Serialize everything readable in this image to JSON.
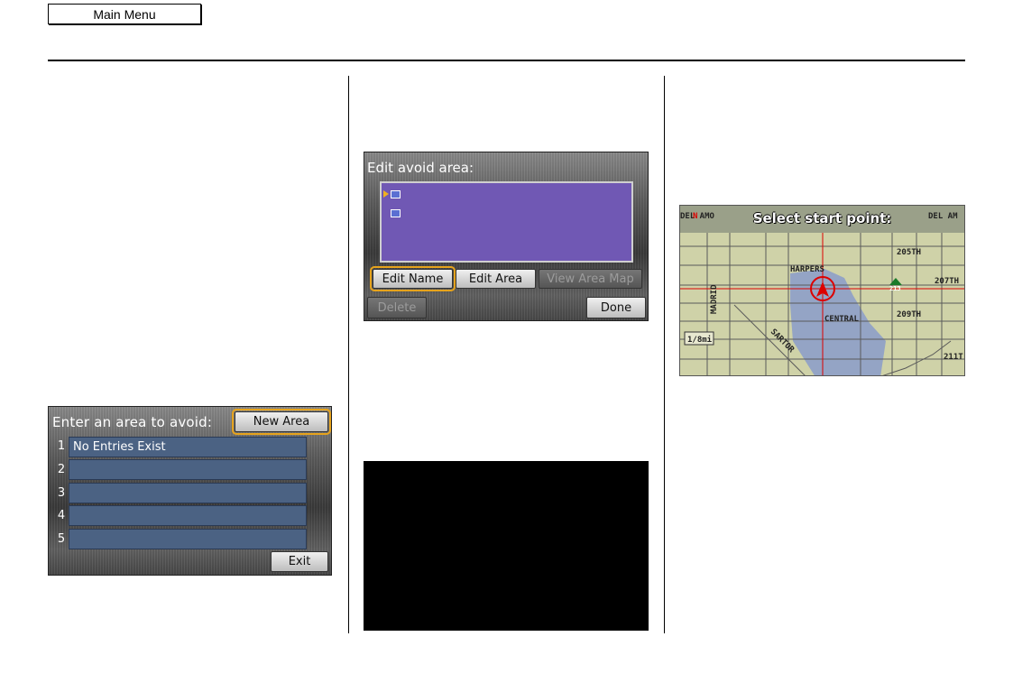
{
  "header": {
    "main_menu_label": "Main Menu"
  },
  "screen_avoid_list": {
    "title": "Enter an area to avoid:",
    "new_area_label": "New Area",
    "rows": [
      {
        "num": "1",
        "text": "No Entries Exist"
      },
      {
        "num": "2",
        "text": ""
      },
      {
        "num": "3",
        "text": ""
      },
      {
        "num": "4",
        "text": ""
      },
      {
        "num": "5",
        "text": ""
      }
    ],
    "exit_label": "Exit"
  },
  "screen_edit_area": {
    "title": "Edit avoid area:",
    "buttons": {
      "edit_name": "Edit Name",
      "edit_area": "Edit Area",
      "view_area_map": "View Area Map",
      "delete": "Delete",
      "done": "Done"
    }
  },
  "screen_map": {
    "title": "Select start point:",
    "labels": {
      "del_amo_left": "DEL AMO",
      "del_amo_right": "DEL AM",
      "harpers": "HARPERS",
      "central": "CENTRAL",
      "madrid": "MADRID",
      "sartori": "SARTOR",
      "205th": "205TH",
      "207th": "207TH",
      "209th": "209TH",
      "211th": "211T",
      "scale": "1/8mi",
      "route": "213",
      "north": "N"
    }
  }
}
